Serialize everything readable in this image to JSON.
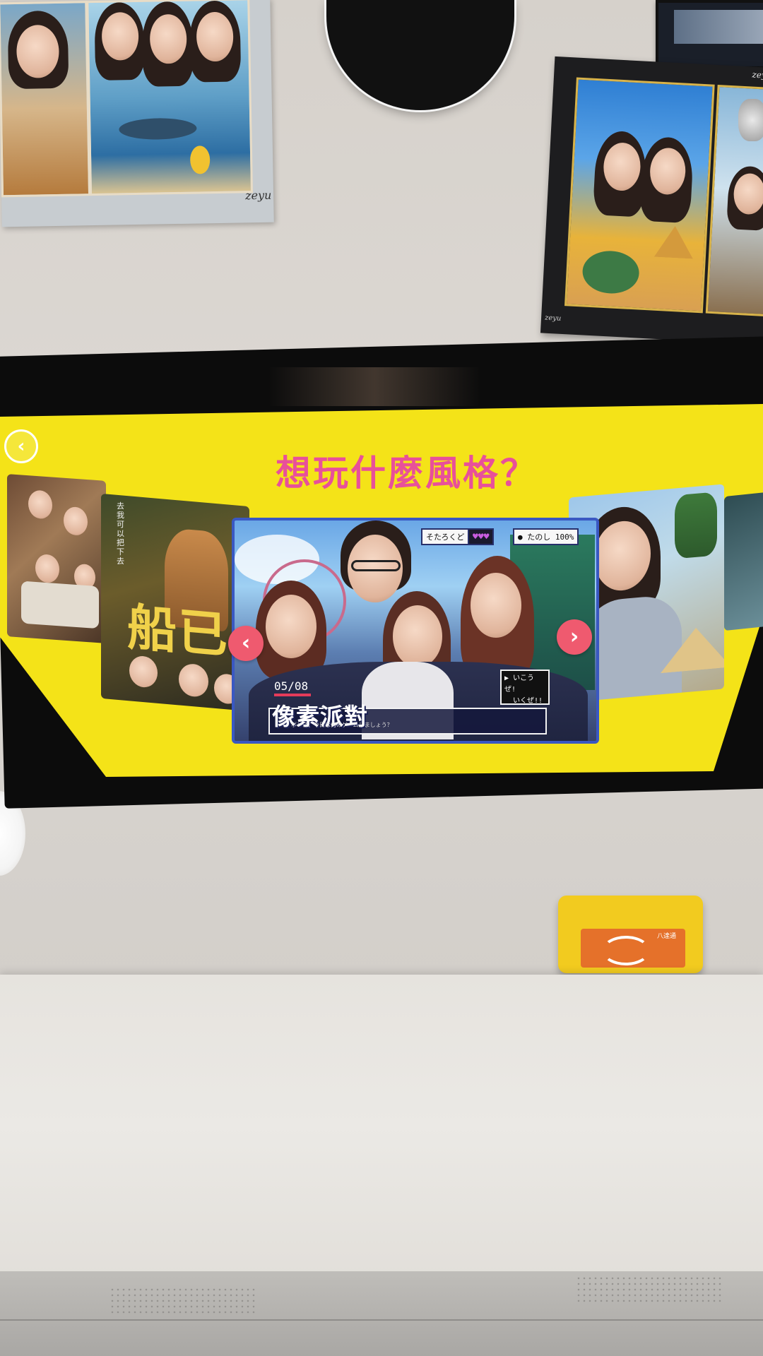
{
  "screen": {
    "title": "想玩什麼風格？",
    "back_icon": "back-arrow-icon",
    "cards": {
      "far_left": {
        "label": ""
      },
      "left": {
        "label": "船已",
        "side_text": "去 我可以把下去"
      },
      "center": {
        "hud_name": "そたろくど",
        "hud_hearts": "♥♥♥",
        "hud_status": "● たのし  100%",
        "date": "05/08",
        "name": "像素派對",
        "subtitle": "ボンス、今日は何のゲームしましょう？",
        "go_line1": "▶ いこうぜ!",
        "go_line2": "いくぜ!!"
      },
      "right": {
        "label": ""
      },
      "far_right": {
        "label": ""
      }
    },
    "nav": {
      "prev_icon": "chevron-left-icon",
      "prev_glyph": "‹",
      "next_icon": "chevron-right-icon",
      "next_glyph": "›"
    }
  },
  "posters": {
    "left_signature": "zeyu",
    "right_signature": "zeyu",
    "right_corner": "zeyu"
  },
  "reader": {
    "label": "八達通"
  },
  "colors": {
    "screen_bg": "#f4e318",
    "title": "#e8509a",
    "arrow": "#ef5a6f",
    "card_border": "#3a58c2"
  }
}
